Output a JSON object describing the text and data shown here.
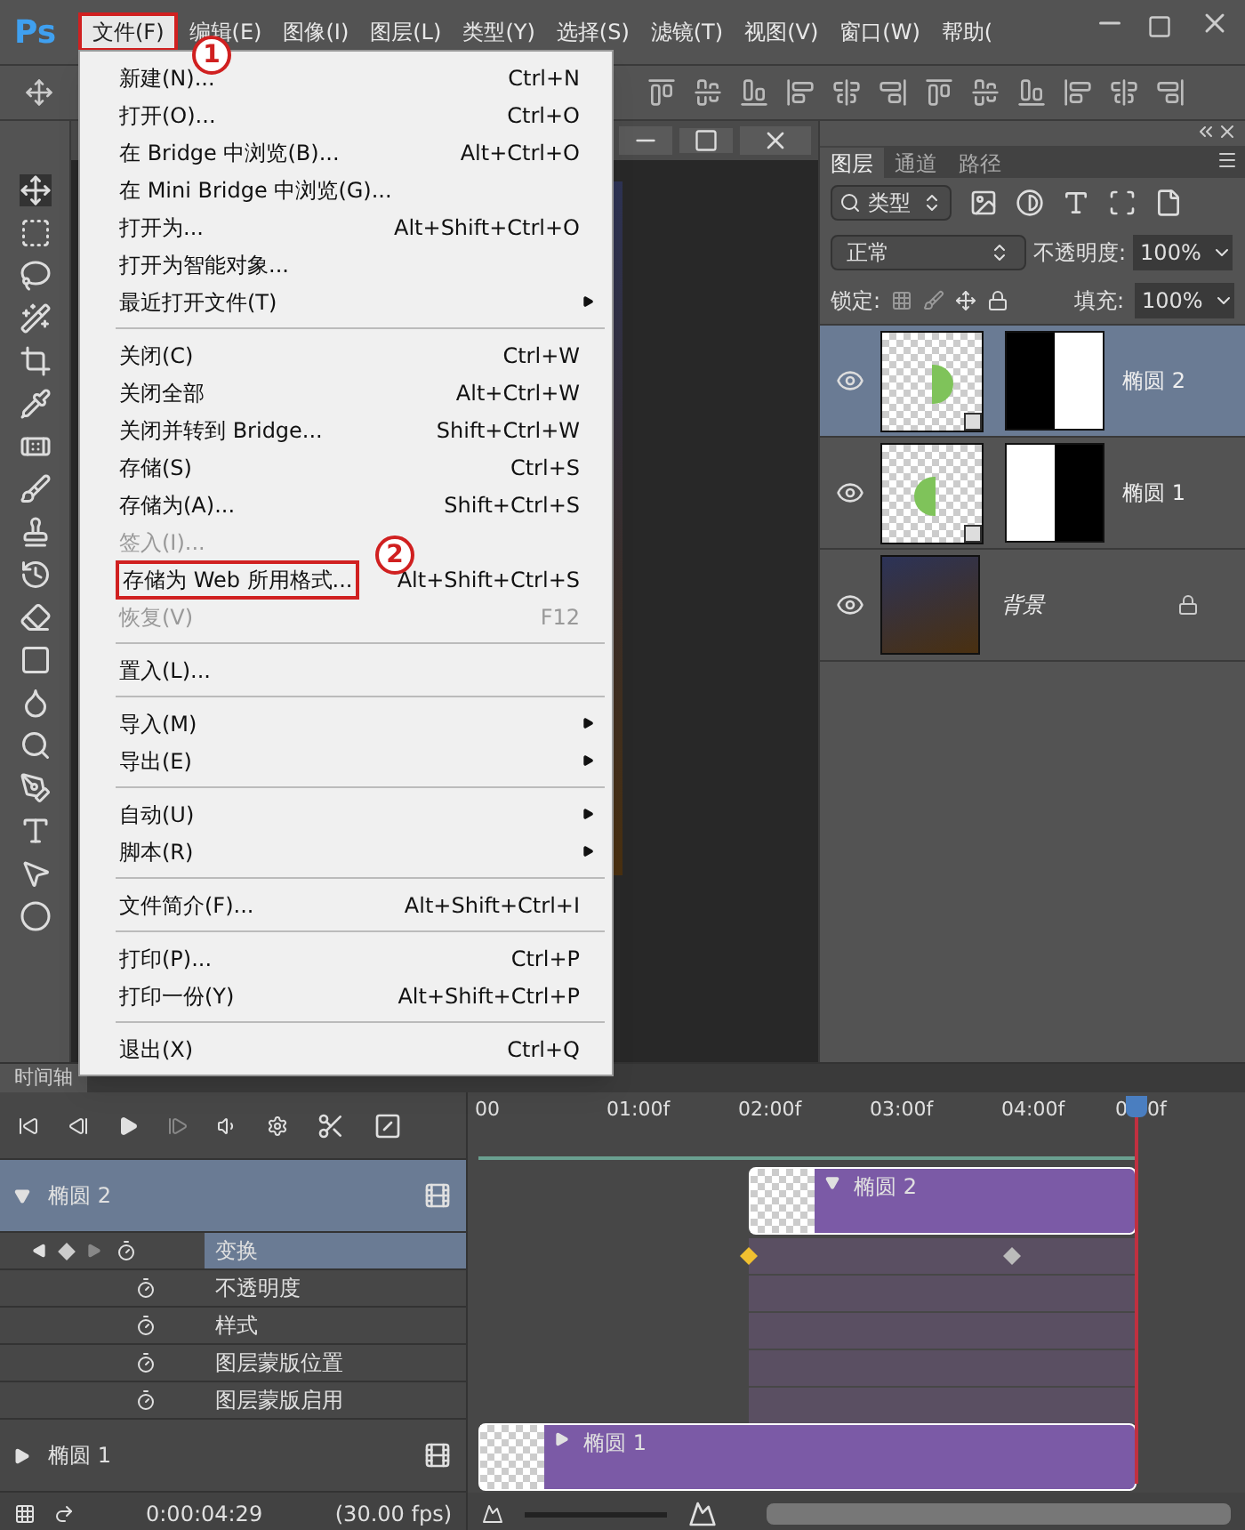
{
  "app_logo": "Ps",
  "menubar": [
    {
      "label": "文件(F)",
      "selected": true
    },
    {
      "label": "编辑(E)",
      "selected": false
    },
    {
      "label": "图像(I)",
      "selected": false
    },
    {
      "label": "图层(L)",
      "selected": false
    },
    {
      "label": "类型(Y)",
      "selected": false
    },
    {
      "label": "选择(S)",
      "selected": false
    },
    {
      "label": "滤镜(T)",
      "selected": false
    },
    {
      "label": "视图(V)",
      "selected": false
    },
    {
      "label": "窗口(W)",
      "selected": false
    },
    {
      "label": "帮助(",
      "selected": false
    }
  ],
  "annotations": [
    "1",
    "2"
  ],
  "file_menu": [
    {
      "kind": "item",
      "label": "新建(N)...",
      "shortcut": "Ctrl+N",
      "disabled": false,
      "submenu": false,
      "highlighted": false
    },
    {
      "kind": "item",
      "label": "打开(O)...",
      "shortcut": "Ctrl+O",
      "disabled": false,
      "submenu": false,
      "highlighted": false
    },
    {
      "kind": "item",
      "label": "在 Bridge 中浏览(B)...",
      "shortcut": "Alt+Ctrl+O",
      "disabled": false,
      "submenu": false,
      "highlighted": false
    },
    {
      "kind": "item",
      "label": "在 Mini Bridge 中浏览(G)...",
      "disabled": false,
      "submenu": false,
      "highlighted": false
    },
    {
      "kind": "item",
      "label": "打开为...",
      "shortcut": "Alt+Shift+Ctrl+O",
      "disabled": false,
      "submenu": false,
      "highlighted": false
    },
    {
      "kind": "item",
      "label": "打开为智能对象...",
      "disabled": false,
      "submenu": false,
      "highlighted": false
    },
    {
      "kind": "item",
      "label": "最近打开文件(T)",
      "disabled": false,
      "submenu": true,
      "highlighted": false
    },
    {
      "kind": "separator"
    },
    {
      "kind": "item",
      "label": "关闭(C)",
      "shortcut": "Ctrl+W",
      "disabled": false,
      "submenu": false,
      "highlighted": false
    },
    {
      "kind": "item",
      "label": "关闭全部",
      "shortcut": "Alt+Ctrl+W",
      "disabled": false,
      "submenu": false,
      "highlighted": false
    },
    {
      "kind": "item",
      "label": "关闭并转到 Bridge...",
      "shortcut": "Shift+Ctrl+W",
      "disabled": false,
      "submenu": false,
      "highlighted": false
    },
    {
      "kind": "item",
      "label": "存储(S)",
      "shortcut": "Ctrl+S",
      "disabled": false,
      "submenu": false,
      "highlighted": false
    },
    {
      "kind": "item",
      "label": "存储为(A)...",
      "shortcut": "Shift+Ctrl+S",
      "disabled": false,
      "submenu": false,
      "highlighted": false
    },
    {
      "kind": "item",
      "label": "签入(I)...",
      "disabled": true,
      "submenu": false,
      "highlighted": false
    },
    {
      "kind": "item",
      "label": "存储为 Web 所用格式...",
      "shortcut": "Alt+Shift+Ctrl+S",
      "disabled": false,
      "submenu": false,
      "highlighted": true
    },
    {
      "kind": "item",
      "label": "恢复(V)",
      "shortcut": "F12",
      "disabled": true,
      "submenu": false,
      "highlighted": false
    },
    {
      "kind": "separator"
    },
    {
      "kind": "item",
      "label": "置入(L)...",
      "disabled": false,
      "submenu": false,
      "highlighted": false
    },
    {
      "kind": "separator"
    },
    {
      "kind": "item",
      "label": "导入(M)",
      "disabled": false,
      "submenu": true,
      "highlighted": false
    },
    {
      "kind": "item",
      "label": "导出(E)",
      "disabled": false,
      "submenu": true,
      "highlighted": false
    },
    {
      "kind": "separator"
    },
    {
      "kind": "item",
      "label": "自动(U)",
      "disabled": false,
      "submenu": true,
      "highlighted": false
    },
    {
      "kind": "item",
      "label": "脚本(R)",
      "disabled": false,
      "submenu": true,
      "highlighted": false
    },
    {
      "kind": "separator"
    },
    {
      "kind": "item",
      "label": "文件简介(F)...",
      "shortcut": "Alt+Shift+Ctrl+I",
      "disabled": false,
      "submenu": false,
      "highlighted": false
    },
    {
      "kind": "separator"
    },
    {
      "kind": "item",
      "label": "打印(P)...",
      "shortcut": "Ctrl+P",
      "disabled": false,
      "submenu": false,
      "highlighted": false
    },
    {
      "kind": "item",
      "label": "打印一份(Y)",
      "shortcut": "Alt+Shift+Ctrl+P",
      "disabled": false,
      "submenu": false,
      "highlighted": false
    },
    {
      "kind": "separator"
    },
    {
      "kind": "item",
      "label": "退出(X)",
      "shortcut": "Ctrl+Q",
      "disabled": false,
      "submenu": false,
      "highlighted": false
    }
  ],
  "layers_panel": {
    "tabs": [
      {
        "label": "图层",
        "selected": true
      },
      {
        "label": "通道",
        "selected": false
      },
      {
        "label": "路径",
        "selected": false
      }
    ],
    "filter": "类型",
    "blend_mode": "正常",
    "opacity_label": "不透明度:",
    "opacity": "100%",
    "lock_label": "锁定:",
    "fill_label": "填充:",
    "fill": "100%",
    "layers": [
      {
        "name": "椭圆 2",
        "kind": "smart",
        "selected": true,
        "visible": true,
        "mask_inverted": false
      },
      {
        "name": "椭圆 1",
        "kind": "smart",
        "selected": false,
        "visible": true,
        "mask_inverted": true
      },
      {
        "name": "背景",
        "kind": "background",
        "selected": false,
        "visible": true,
        "locked": true
      }
    ]
  },
  "timeline": {
    "tab": "时间轴",
    "ruler": [
      "00",
      "01:00f",
      "02:00f",
      "03:00f",
      "04:00f"
    ],
    "ruler_cut": [
      "0",
      "0f"
    ],
    "tracks": [
      {
        "name": "椭圆 2",
        "expanded": true,
        "selected": true,
        "clip": "椭圆 2",
        "properties": [
          {
            "name": "变换",
            "selected": true,
            "keyframes": [
              {
                "selected": true
              },
              {
                "selected": false
              }
            ]
          },
          {
            "name": "不透明度",
            "selected": false
          },
          {
            "name": "样式",
            "selected": false
          },
          {
            "name": "图层蒙版位置",
            "selected": false
          },
          {
            "name": "图层蒙版启用",
            "selected": false
          }
        ]
      },
      {
        "name": "椭圆 1",
        "expanded": false,
        "selected": false,
        "clip": "椭圆 1"
      }
    ],
    "timecode": "0:00:04:29",
    "fps": "(30.00 fps)"
  }
}
